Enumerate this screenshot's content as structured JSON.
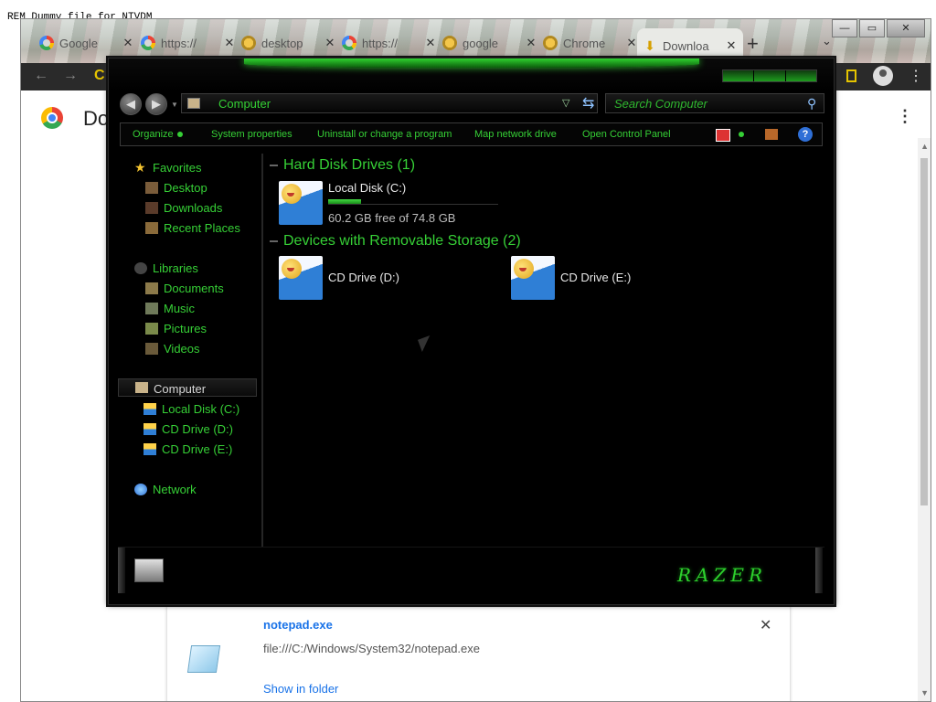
{
  "background_text": "REM Dummy file for NTVDM",
  "chrome": {
    "tabs": [
      {
        "title": "Google",
        "icon": "google-icon"
      },
      {
        "title": "https://",
        "icon": "google-icon"
      },
      {
        "title": "desktop",
        "icon": "yellow-site-icon"
      },
      {
        "title": "https://",
        "icon": "google-icon"
      },
      {
        "title": "google",
        "icon": "yellow-site-icon"
      },
      {
        "title": "Chrome",
        "icon": "yellow-site-icon"
      },
      {
        "title": "Downloa",
        "icon": "download-icon",
        "active": true
      }
    ],
    "new_tab": "+",
    "tab_dropdown": "⌄",
    "window_buttons": {
      "minimize": "—",
      "maximize": "▭",
      "close": "✕"
    },
    "toolbar": {
      "back": "←",
      "forward": "→",
      "reload": "C",
      "menu": "⋮"
    },
    "page": {
      "title_fragment": "Do",
      "menu": "⋮"
    },
    "download": {
      "name": "notepad.exe",
      "path": "file:///C:/Windows/System32/notepad.exe",
      "show_in_folder": "Show in folder",
      "close": "✕"
    }
  },
  "explorer": {
    "address": "Computer",
    "search_placeholder": "Search Computer",
    "commands": {
      "organize": "Organize",
      "system_properties": "System properties",
      "uninstall": "Uninstall or change a program",
      "map_drive": "Map network drive",
      "control_panel": "Open Control Panel",
      "help": "?"
    },
    "nav": {
      "favorites": "Favorites",
      "desktop": "Desktop",
      "downloads": "Downloads",
      "recent": "Recent Places",
      "libraries": "Libraries",
      "documents": "Documents",
      "music": "Music",
      "pictures": "Pictures",
      "videos": "Videos",
      "computer": "Computer",
      "local_disk": "Local Disk (C:)",
      "cd_d": "CD Drive (D:)",
      "cd_e": "CD Drive (E:)",
      "network": "Network"
    },
    "groups": {
      "hdd": "Hard Disk Drives (1)",
      "removable": "Devices with Removable Storage (2)"
    },
    "drives": {
      "c": {
        "label": "Local Disk (C:)",
        "free": "60.2 GB free of 74.8 GB",
        "used_fraction": 0.195
      },
      "d": {
        "label": "CD Drive (D:)"
      },
      "e": {
        "label": "CD Drive (E:)"
      }
    },
    "brand": "RAZER",
    "colors": {
      "accent_green": "#36d036",
      "background": "#000000"
    }
  }
}
